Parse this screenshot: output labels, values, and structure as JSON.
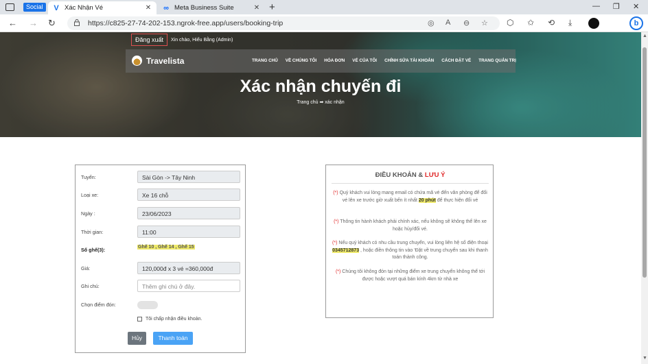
{
  "browser": {
    "social_badge": "Social",
    "tabs": [
      {
        "title": "Xác Nhận Vé",
        "favicon": "V"
      },
      {
        "title": "Meta Business Suite",
        "favicon": "∞"
      }
    ],
    "url": "https://c825-27-74-202-153.ngrok-free.app/users/booking-trip"
  },
  "header": {
    "logout_label": "Đăng xuất",
    "greeting": "Xin chào, Hiếu Bằng (Admin)",
    "brand": "Travelista",
    "menu": [
      "TRANG CHỦ",
      "VỀ CHÚNG TÔI",
      "HÓA ĐƠN",
      "VÉ CỦA TÔI",
      "CHỈNH SỬA TÀI KHOẢN",
      "CÁCH ĐẶT VÉ",
      "TRANG QUẢN TRỊ"
    ],
    "page_title": "Xác nhận chuyến đi",
    "breadcrumb": "Trang chủ ➡ xác nhận"
  },
  "form": {
    "route_label": "Tuyến:",
    "route_value": "Sài Gòn -> Tây Ninh",
    "vehicle_label": "Loại xe:",
    "vehicle_value": "Xe 16 chỗ",
    "date_label": "Ngày :",
    "date_value": "23/06/2023",
    "time_label": "Thời gian:",
    "time_value": "11:00",
    "seats_label": "Số ghế(3):",
    "seats_value": "Ghế 10 , Ghế 14 , Ghế 15",
    "price_label": "Giá:",
    "price_value": "120,000đ x 3 vé =360,000đ",
    "note_label": "Ghi chú:",
    "note_placeholder": "Thêm ghi chú ở đây.",
    "pickup_label": "Chọn điểm đón:",
    "agree_label": "Tôi chấp nhận điều khoản.",
    "cancel_label": "Hủy",
    "pay_label": "Thanh toán"
  },
  "terms": {
    "title_prefix": "ĐIỀU KHOẢN &",
    "title_highlight": "LƯU Ý",
    "item1_a": "Quý khách vui lòng mang email có chứa mã vé đến văn phòng để đổi vé lên xe trước giờ xuất bến ít nhất",
    "item1_hl": "20 phút",
    "item1_b": "để thực hiện đổi vé",
    "item2": "Thông tin hành khách phải chính xác, nếu không sẽ không thể lên xe hoặc hủy/đổi vé.",
    "item3_a": "Nếu quý khách có nhu cầu trung chuyển, vui lòng liên hệ số điện thoại",
    "item3_hl": "0345712873",
    "item3_b": ", hoặc điền thông tin vào 'Đặt về trung chuyển sau khi thanh toán thành công.",
    "item4": "Chúng tôi không đón tại những điểm xe trung chuyển không thể tới được hoặc vượt quá bán kính 4km từ nhà xe",
    "asterisk": "(*)"
  },
  "colors": {
    "accent_red": "#e02828",
    "highlight": "#eee96a",
    "pay_button": "#4aa3f5",
    "cancel_button": "#6c757d"
  }
}
